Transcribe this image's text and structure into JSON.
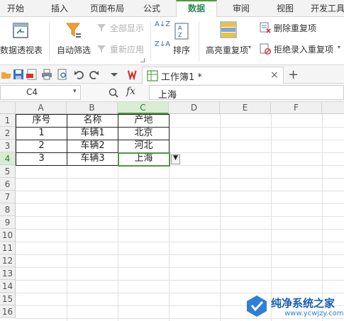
{
  "ribbon_tabs": [
    {
      "label": "开始"
    },
    {
      "label": "插入"
    },
    {
      "label": "页面布局"
    },
    {
      "label": "公式"
    },
    {
      "label": "数据",
      "active": true
    },
    {
      "label": "审阅"
    },
    {
      "label": "视图"
    },
    {
      "label": "开发工具"
    }
  ],
  "ribbon": {
    "pivot_label": "数据透视表",
    "autofilter_label": "自动筛选",
    "show_all_label": "全部显示",
    "reapply_label": "重新应用",
    "sort_label": "排序",
    "highlight_dup_label": "高亮重复项",
    "delete_dup_label": "删除重复项",
    "reject_dup_label": "拒绝录入重复项",
    "sort_az": "A↓Z",
    "sort_za": "Z↓A"
  },
  "document": {
    "tab_title": "工作簿1 *",
    "add_tab": "+"
  },
  "formula_bar": {
    "name_box": "C4",
    "fx_label": "fx",
    "content": "上海"
  },
  "columns": [
    "A",
    "B",
    "C",
    "D",
    "E",
    "F"
  ],
  "rows": [
    "1",
    "2",
    "3",
    "4",
    "5",
    "6",
    "7",
    "8",
    "9",
    "10",
    "11",
    "12",
    "13",
    "14",
    "15",
    "16"
  ],
  "table": {
    "headers": [
      "序号",
      "名称",
      "产地"
    ],
    "rows": [
      [
        "1",
        "车辆1",
        "北京"
      ],
      [
        "2",
        "车辆2",
        "河北"
      ],
      [
        "3",
        "车辆3",
        "上海"
      ]
    ]
  },
  "watermark": {
    "title": "纯净系统之家",
    "url": "www.ycwjzy.com"
  },
  "colors": {
    "accent": "#4e9a3a",
    "wps_red": "#d9302c"
  }
}
